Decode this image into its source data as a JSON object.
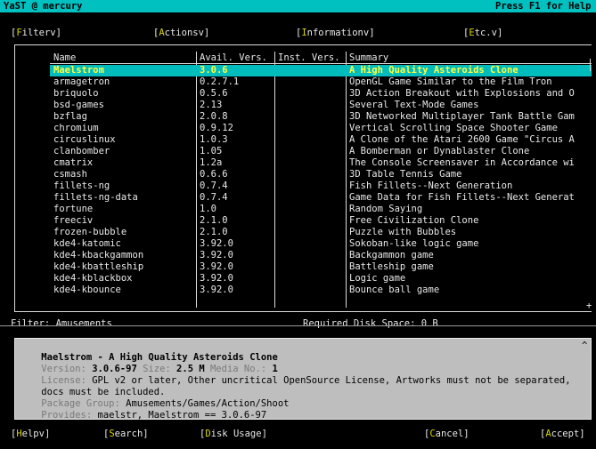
{
  "window": {
    "title": "YaST @ mercury",
    "help_hint": "Press F1 for Help"
  },
  "menu": [
    {
      "first": "F",
      "rest": "ilter",
      "arrow": "v"
    },
    {
      "first": "A",
      "rest": "ctions",
      "arrow": "v"
    },
    {
      "first": "I",
      "rest": "nformation",
      "arrow": "v"
    },
    {
      "first": "E",
      "rest": "tc.",
      "arrow": "v"
    }
  ],
  "table": {
    "headers": [
      "Name",
      "Avail. Vers.",
      "Inst. Vers.",
      "Summary"
    ],
    "rows": [
      {
        "name": "Maelstrom",
        "avail": "3.0.6",
        "inst": "",
        "summary": "A High Quality Asteroids Clone",
        "selected": true
      },
      {
        "name": "armagetron",
        "avail": "0.2.7.1",
        "inst": "",
        "summary": "OpenGL Game Similar to the Film Tron"
      },
      {
        "name": "briquolo",
        "avail": "0.5.6",
        "inst": "",
        "summary": "3D Action Breakout with Explosions and O"
      },
      {
        "name": "bsd-games",
        "avail": "2.13",
        "inst": "",
        "summary": "Several Text-Mode Games"
      },
      {
        "name": "bzflag",
        "avail": "2.0.8",
        "inst": "",
        "summary": "3D Networked Multiplayer Tank Battle Gam"
      },
      {
        "name": "chromium",
        "avail": "0.9.12",
        "inst": "",
        "summary": "Vertical Scrolling Space Shooter Game"
      },
      {
        "name": "circuslinux",
        "avail": "1.0.3",
        "inst": "",
        "summary": "A Clone of the Atari 2600 Game \"Circus A"
      },
      {
        "name": "clanbomber",
        "avail": "1.05",
        "inst": "",
        "summary": "A Bomberman or Dynablaster Clone"
      },
      {
        "name": "cmatrix",
        "avail": "1.2a",
        "inst": "",
        "summary": "The Console Screensaver in Accordance wi"
      },
      {
        "name": "csmash",
        "avail": "0.6.6",
        "inst": "",
        "summary": "3D Table Tennis Game"
      },
      {
        "name": "fillets-ng",
        "avail": "0.7.4",
        "inst": "",
        "summary": "Fish Fillets--Next Generation"
      },
      {
        "name": "fillets-ng-data",
        "avail": "0.7.4",
        "inst": "",
        "summary": "Game Data for Fish Fillets--Next Generat"
      },
      {
        "name": "fortune",
        "avail": "1.0",
        "inst": "",
        "summary": "Random Saying"
      },
      {
        "name": "freeciv",
        "avail": "2.1.0",
        "inst": "",
        "summary": "Free Civilization Clone"
      },
      {
        "name": "frozen-bubble",
        "avail": "2.1.0",
        "inst": "",
        "summary": "Puzzle with Bubbles"
      },
      {
        "name": "kde4-katomic",
        "avail": "3.92.0",
        "inst": "",
        "summary": "Sokoban-like logic game"
      },
      {
        "name": "kde4-kbackgammon",
        "avail": "3.92.0",
        "inst": "",
        "summary": "Backgammon game"
      },
      {
        "name": "kde4-kbattleship",
        "avail": "3.92.0",
        "inst": "",
        "summary": "Battleship game"
      },
      {
        "name": "kde4-kblackbox",
        "avail": "3.92.0",
        "inst": "",
        "summary": "Logic game"
      },
      {
        "name": "kde4-kbounce",
        "avail": "3.92.0",
        "inst": "",
        "summary": "Bounce ball game"
      }
    ]
  },
  "status": {
    "filter": "Filter: Amusements",
    "disk_space": "Required Disk Space: 0 B"
  },
  "details": {
    "heading": "Maelstrom - A High Quality Asteroids Clone",
    "version_label": "Version:",
    "version_value": "3.0.6-97",
    "size_label": "Size:",
    "size_value": "2.5 M",
    "media_label": "Media No.:",
    "media_value": "1",
    "license_label": "License:",
    "license_value": "GPL v2 or later, Other uncritical OpenSource License, Artworks must not be separated,",
    "license_cont": "docs must be included.",
    "group_label": "Package Group:",
    "group_value": "Amusements/Games/Action/Shoot",
    "provides_label": "Provides:",
    "provides_value": "maelstr, Maelstrom == 3.0.6-97"
  },
  "buttons": [
    {
      "first": "H",
      "rest": "elp",
      "arrow": "v"
    },
    {
      "first": "S",
      "rest": "earch",
      "arrow": ""
    },
    {
      "first": "D",
      "rest": "isk Usage",
      "arrow": ""
    },
    {
      "first": "C",
      "rest": "ancel",
      "arrow": ""
    },
    {
      "first": "A",
      "rest": "ccept",
      "arrow": ""
    }
  ],
  "colors": {
    "selection": "#00bcbc",
    "titlebar": "#00c0c0",
    "hotkey": "#d8d800",
    "info_bg": "#bebebe"
  }
}
